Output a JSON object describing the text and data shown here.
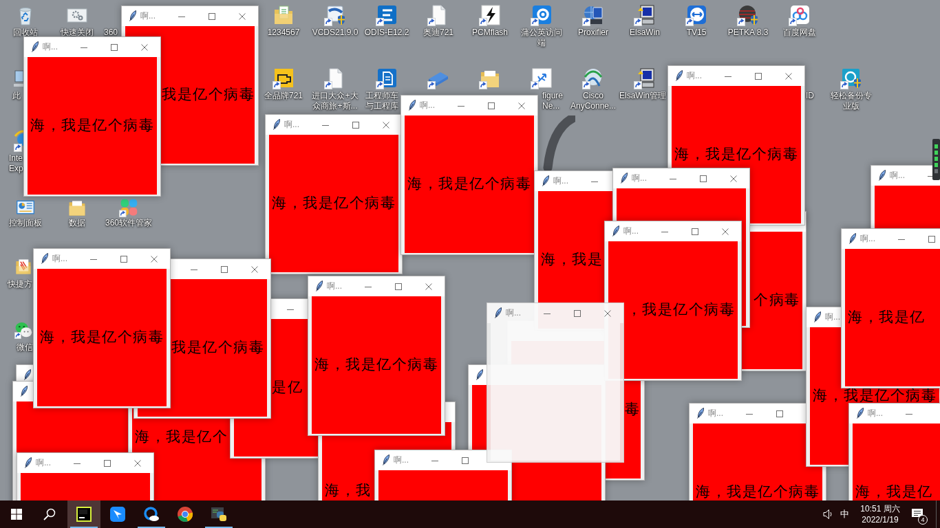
{
  "desktop": {
    "icons": [
      {
        "selected": false,
        "lines": [
          "回收站"
        ]
      },
      {
        "selected": false,
        "lines": [
          "快速关闭"
        ]
      },
      {
        "selected": false,
        "lines": [
          "360"
        ]
      },
      {
        "selected": false,
        "lines": [
          "1234567"
        ]
      },
      {
        "selected": false,
        "lines": [
          "VCDS21.9.0"
        ]
      },
      {
        "selected": false,
        "lines": [
          "ODIS-E12.2"
        ]
      },
      {
        "selected": false,
        "lines": [
          "奥迪721"
        ]
      },
      {
        "selected": false,
        "lines": [
          "PCMflash"
        ]
      },
      {
        "selected": false,
        "lines": [
          "蒲公英访问",
          "端"
        ]
      },
      {
        "selected": false,
        "lines": [
          "Proxifier"
        ]
      },
      {
        "selected": false,
        "lines": [
          "ElsaWin"
        ]
      },
      {
        "selected": false,
        "lines": [
          "TV15"
        ]
      },
      {
        "selected": false,
        "lines": [
          "PETKA 8.3"
        ]
      },
      {
        "selected": false,
        "lines": [
          "百度网盘"
        ]
      },
      {
        "selected": false,
        "lines": [
          "此"
        ]
      },
      {
        "selected": false,
        "lines": [
          "全品牌721"
        ]
      },
      {
        "selected": false,
        "lines": [
          "进口大众+大",
          "众商旅+斯..."
        ]
      },
      {
        "selected": false,
        "lines": [
          "工程师车",
          "与工程库"
        ]
      },
      {
        "selected": false
      },
      {
        "selected": false
      },
      {
        "selected": false,
        "lines": [
          "figure",
          "Ne..."
        ]
      },
      {
        "selected": false,
        "lines": [
          "Cisco",
          "AnyConne..."
        ]
      },
      {
        "selected": false,
        "lines": [
          "ElsaWin管理"
        ]
      },
      {
        "selected": false,
        "lines": [
          "ID"
        ]
      },
      {
        "selected": false,
        "lines": [
          "轻松备份专",
          "业版"
        ]
      },
      {
        "selected": false,
        "lines": [
          "Inte",
          "Exp"
        ]
      },
      {
        "selected": false,
        "lines": [
          "控制面板"
        ]
      },
      {
        "selected": false,
        "lines": [
          "数据"
        ]
      },
      {
        "selected": false,
        "lines": [
          "360软件管家"
        ]
      },
      {
        "selected": false,
        "lines": [
          "快捷方"
        ]
      },
      {
        "selected": false,
        "lines": [
          "微信"
        ]
      }
    ]
  },
  "windows": [
    {
      "translucent": false,
      "title": "啊...",
      "message": "我是亿个病毒"
    },
    {
      "translucent": false,
      "title": "啊...",
      "message": "海，我是亿个病毒"
    },
    {
      "translucent": false,
      "title": "啊...",
      "message": "海，我是亿个病毒"
    },
    {
      "translucent": false,
      "title": "啊...",
      "message": "海，我是亿个病毒"
    },
    {
      "translucent": false,
      "title": "啊...",
      "message": "海，我是亿个病毒"
    },
    {
      "translucent": false,
      "title": "啊..."
    },
    {
      "translucent": false,
      "title": "啊...",
      "message": "海，我是"
    },
    {
      "translucent": false,
      "title": "啊..."
    },
    {
      "translucent": false,
      "message": "个病毒"
    },
    {
      "translucent": false,
      "title": "啊...",
      "message": "，我是亿个病毒"
    },
    {
      "translucent": false,
      "title": "啊...",
      "message": "海，我是亿"
    },
    {
      "translucent": false,
      "title": "啊...",
      "message": "海，我是亿个病毒"
    },
    {
      "translucent": false,
      "message": "我是亿个病毒"
    },
    {
      "translucent": false,
      "title": "啊...",
      "message": "海，我是亿个病毒"
    },
    {
      "translucent": false,
      "message": "是亿"
    },
    {
      "translucent": true,
      "title": "啊..."
    },
    {
      "translucent": false,
      "title": "啊...",
      "message": "海，我是亿个病毒"
    },
    {
      "translucent": false,
      "message": "毒"
    },
    {
      "translucent": false,
      "message": "海，我是亿个"
    },
    {
      "translucent": false
    },
    {
      "translucent": false
    },
    {
      "translucent": false
    },
    {
      "translucent": false,
      "message": "海，我"
    },
    {
      "translucent": false,
      "title": "啊...",
      "message": "海，我是亿个病毒"
    },
    {
      "translucent": false,
      "title": "啊...",
      "message": "海，我是亿"
    },
    {
      "translucent": false,
      "title": "啊..."
    },
    {
      "translucent": false,
      "title": "啊..."
    }
  ],
  "taskbar": {
    "apps": [
      {
        "selected": true,
        "running": true
      },
      {
        "selected": false,
        "running": false
      },
      {
        "selected": false,
        "running": true
      },
      {
        "selected": false,
        "running": false
      },
      {
        "selected": false,
        "running": true
      }
    ],
    "tray": {
      "input_method": "中",
      "time": "10:51 周六",
      "date": "2022/1/19",
      "notification_count": "4"
    }
  }
}
